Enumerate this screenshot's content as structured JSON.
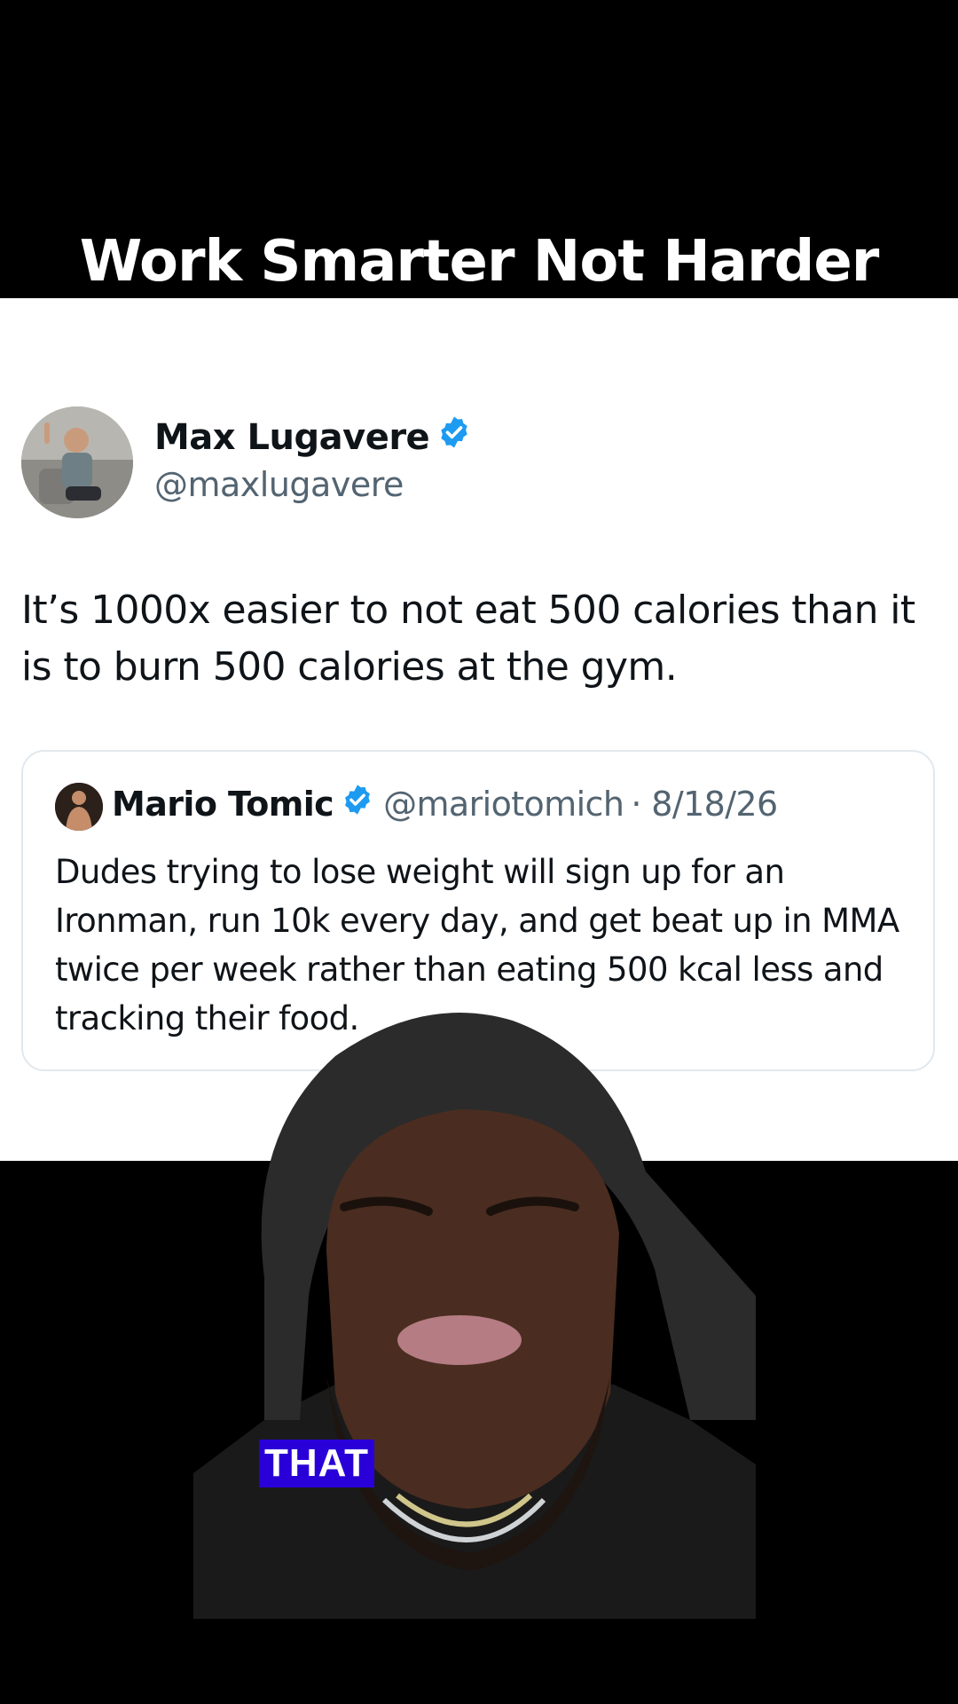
{
  "video": {
    "title": "Work Smarter Not Harder",
    "caption": "THAT"
  },
  "tweet": {
    "author_name": "Max Lugavere",
    "author_handle": "@maxlugavere",
    "text": "It’s 1000x easier to not eat 500 calories than it is to burn 500 calories at the gym.",
    "verified": true
  },
  "quoted_tweet": {
    "author_name": "Mario Tomic",
    "author_handle": "@mariotomich",
    "date": "· 8/18/26",
    "text": "Dudes trying to lose weight will sign up for an Ironman, run 10k every day, and get beat up in MMA twice per week rather than eating 500 kcal less and tracking their food.",
    "verified": true
  },
  "colors": {
    "verified_badge": "#1d9bf0",
    "caption_highlight": "#2a00d8",
    "text_primary": "#0f1419",
    "text_secondary": "#536471"
  },
  "icons": [
    "verified-badge-icon"
  ]
}
